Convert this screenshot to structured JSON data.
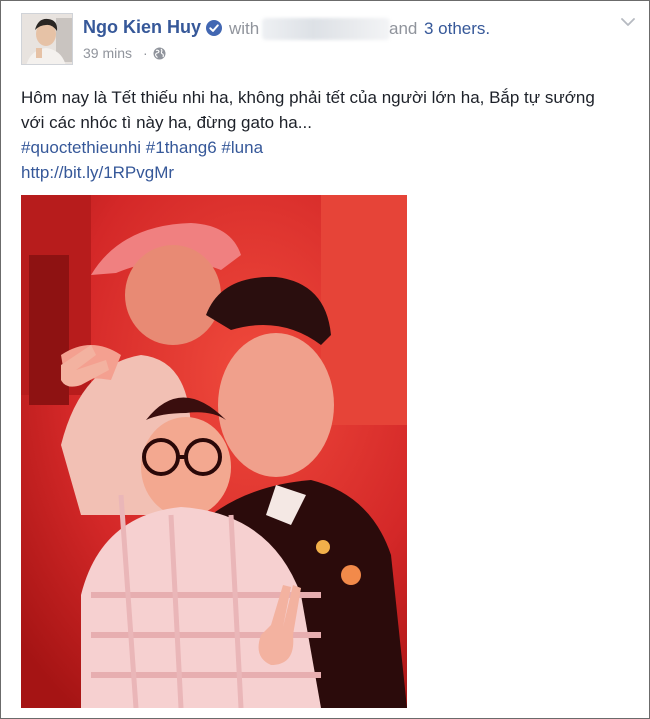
{
  "post": {
    "author": "Ngo Kien Huy",
    "with_label": "with",
    "and_label": "and",
    "others_label": "3 others.",
    "timestamp": "39 mins",
    "separator": "·",
    "text": "Hôm nay là Tết thiếu nhi ha, không phải tết của người lớn ha, Bắp tự sướng với các nhóc tì này ha, đừng gato ha...",
    "hashtags": [
      "#quoctethieunhi",
      "#1thang6",
      "#luna"
    ],
    "link": "http://bit.ly/1RPvgMr"
  },
  "icons": {
    "verified": "verified-badge-icon",
    "audience": "globe-icon",
    "menu": "chevron-down-icon"
  },
  "colors": {
    "link_blue": "#365899",
    "meta_gray": "#90949c",
    "verified_blue": "#4267b2",
    "photo_red": "#d52a2a"
  }
}
